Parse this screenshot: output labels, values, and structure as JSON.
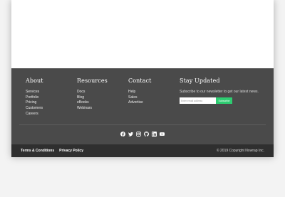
{
  "footer": {
    "about": {
      "title": "About",
      "items": [
        "Services",
        "Portfolio",
        "Pricing",
        "Customers",
        "Careers"
      ]
    },
    "resources": {
      "title": "Resources",
      "items": [
        "Docs",
        "Blog",
        "eBooks",
        "Webinars"
      ]
    },
    "contact": {
      "title": "Contact",
      "items": [
        "Help",
        "Sales",
        "Advertise"
      ]
    },
    "newsletter": {
      "title": "Stay Updated",
      "description": "Subscribe to our newsletter to get our latest news.",
      "email_placeholder": "Enter email address",
      "button_label": "Subscribe"
    },
    "social_icons": [
      "facebook-icon",
      "twitter-icon",
      "instagram-icon",
      "github-icon",
      "linkedin-icon",
      "youtube-icon"
    ]
  },
  "bottom_bar": {
    "links": [
      "Terms & Conditions",
      "Privacy Policy"
    ],
    "copyright": "© 2019 Copyright Nowrap Inc."
  },
  "colors": {
    "footer_bg": "#4a4a4a",
    "bottom_bar_bg": "#2f2f2f",
    "accent": "#2ecc71",
    "page_bg": "#f3f3f3"
  }
}
